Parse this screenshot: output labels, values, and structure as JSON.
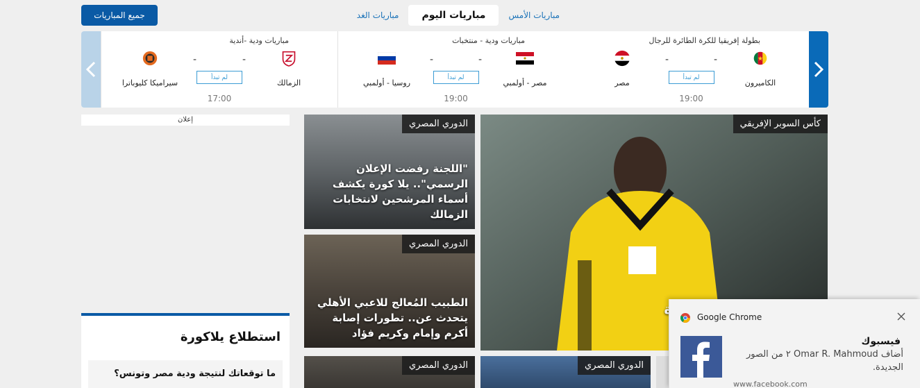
{
  "topbar": {
    "all_matches": "جميع المباريات",
    "tabs": [
      "مباريات الأمس",
      "مباريات اليوم",
      "مباريات الغد"
    ]
  },
  "matches": [
    {
      "competition": "بطولة إفريقيا للكرة الطائرة للرجال",
      "home": "الكاميرون",
      "away": "مصر",
      "home_score": "-",
      "away_score": "-",
      "status": "لم تبدأ",
      "time": "19:00"
    },
    {
      "competition": "مباريات ودية - منتخبات",
      "home": "مصر - أولمبي",
      "away": "روسيا - أولمبي",
      "home_score": "-",
      "away_score": "-",
      "status": "لم تبدأ",
      "time": "19:00"
    },
    {
      "competition": "مباريات ودية -أندية",
      "home": "الزمالك",
      "away": "سيراميكا كليوباترا",
      "home_score": "-",
      "away_score": "-",
      "status": "لم تبدأ",
      "time": "17:00"
    }
  ],
  "ad_label": "إعلان",
  "news": {
    "main": {
      "tag": "كأس السوبر الإفريقي",
      "headline": "م أنتوني موديست لمدة"
    },
    "a": {
      "tag": "الدوري المصري",
      "headline": "\"اللجنة رفضت الإعلان الرسمي\".. يلا كورة يكشف أسماء المرشحين لانتخابات الزمالك"
    },
    "b": {
      "tag": "الدوري المصري",
      "headline": "الطبيب المُعالج للاعبي الأهلي يتحدث عن.. تطورات إصابة أكرم وإمام وكريم فؤاد"
    },
    "c": {
      "tag": "الدوري المصري"
    },
    "d": {
      "tag": "الدوري المصري"
    }
  },
  "poll": {
    "title": "استطلاع يلاكورة",
    "question": "ما توقعاتك لنتيجة ودية مصر وتونس؟"
  },
  "notification": {
    "app": "Google Chrome",
    "title": "فيسبوك",
    "body": "أضاف Omar R. Mahmoud ٢ من الصور الجديدة.",
    "url": "www.facebook.com"
  }
}
